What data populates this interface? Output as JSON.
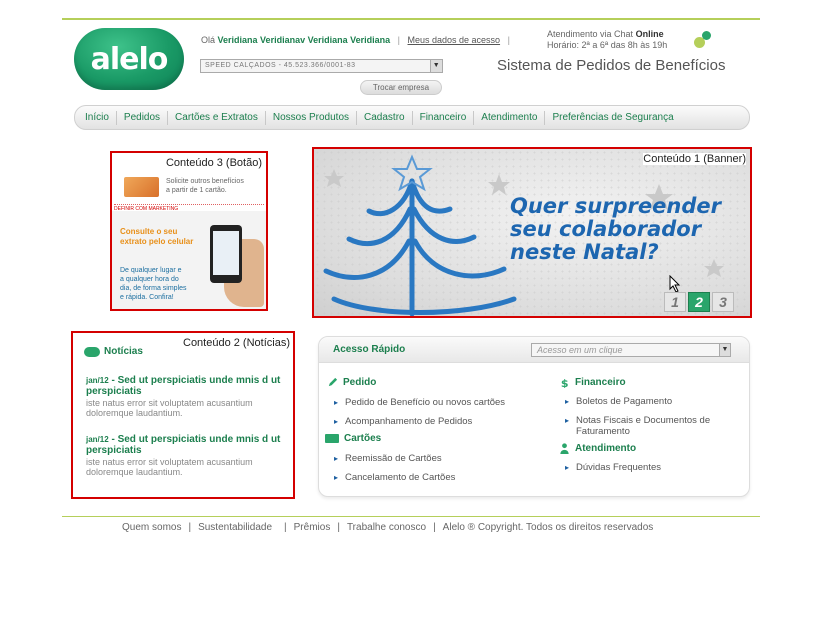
{
  "logo": {
    "text": "alelo"
  },
  "header": {
    "greeting_prefix": "Olá",
    "user_name": "Veridiana Veridianav Veridiana Veridiana",
    "my_data_link": "Meus dados de acesso",
    "chat_line1_prefix": "Atendimento via Chat",
    "chat_status": "Online",
    "chat_line2": "Horário: 2ª a 6ª das 8h às 19h",
    "company_select": "SPEED CALÇADOS - 45.523.366/0001-83",
    "change_company_button": "Trocar empresa",
    "system_title": "Sistema de Pedidos de Benefícios"
  },
  "nav": {
    "items": [
      "Início",
      "Pedidos",
      "Cartões e Extratos",
      "Nossos Produtos",
      "Cadastro",
      "Financeiro",
      "Atendimento",
      "Preferências de Segurança"
    ]
  },
  "content3": {
    "label": "Conteúdo 3 (Botão)",
    "promo_line1": "Solicite outros benefícios",
    "promo_line2": "a partir de 1 cartão.",
    "marketing_note": "DEFINIR COM MARKETING",
    "cel_title_line1": "Consulte o seu",
    "cel_title_line2": "extrato pelo celular",
    "cel_text_line1": "De qualquer lugar e",
    "cel_text_line2": "a qualquer hora do",
    "cel_text_line3": "dia, de forma simples",
    "cel_text_line4": "e rápida. Confira!"
  },
  "content1": {
    "label": "Conteúdo 1 (Banner)",
    "headline_line1": "Quer surpreender",
    "headline_line2": "seu colaborador",
    "headline_line3": "neste Natal?",
    "pages": [
      "1",
      "2",
      "3"
    ],
    "active_page": "2"
  },
  "content2": {
    "label": "Conteúdo 2 (Notícias)",
    "title": "Notícias",
    "news": [
      {
        "date": "jan/12",
        "title": "Sed ut perspiciatis unde mnis d ut perspiciatis",
        "desc": "iste natus error sit voluptatem acusantium doloremque laudantium."
      },
      {
        "date": "jan/12",
        "title": "Sed ut perspiciatis unde mnis d ut perspiciatis",
        "desc": "iste natus error sit voluptatem acusantium doloremque laudantium."
      }
    ]
  },
  "quick_access": {
    "title": "Acesso Rápido",
    "placeholder": "Acesso em um clique",
    "pedido": {
      "label": "Pedido",
      "links": [
        "Pedido de Benefício ou novos cartões",
        "Acompanhamento de Pedidos"
      ]
    },
    "cartoes": {
      "label": "Cartões",
      "links": [
        "Reemissão de Cartões",
        "Cancelamento de Cartões"
      ]
    },
    "financeiro": {
      "label": "Financeiro",
      "links": [
        "Boletos de Pagamento",
        "Notas Fiscais e Documentos de Faturamento"
      ]
    },
    "atendimento": {
      "label": "Atendimento",
      "links": [
        "Dúvidas Frequentes"
      ]
    }
  },
  "footer": {
    "links": [
      "Quem somos",
      "Sustentabilidade",
      "Prêmios",
      "Trabalhe conosco"
    ],
    "copyright": "Alelo ® Copyright. Todos os direitos reservados"
  },
  "colors": {
    "brand_green": "#1c7f4e",
    "accent_green": "#2aa56b",
    "lime": "#b5cf5a",
    "highlight_red": "#d40000",
    "banner_blue": "#1d66b0"
  }
}
